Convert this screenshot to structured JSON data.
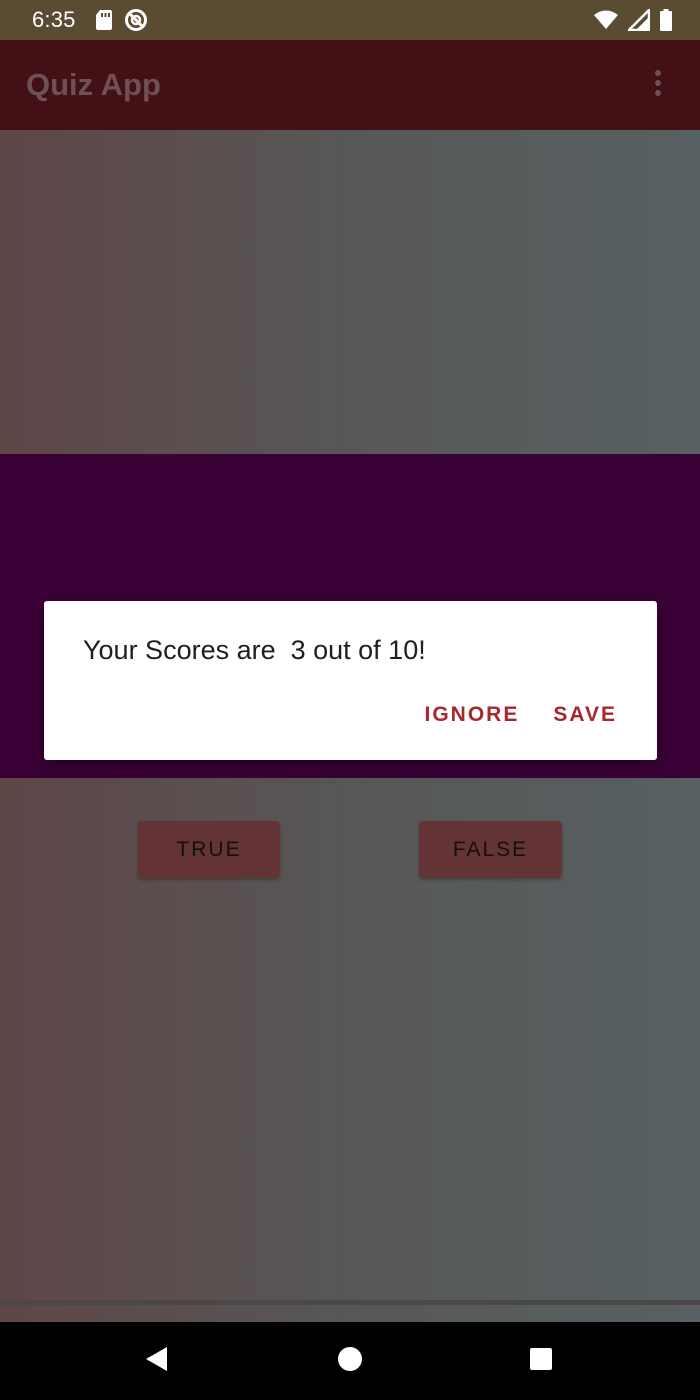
{
  "status_bar": {
    "time": "6:35",
    "icons": [
      "sd-card-icon",
      "do-not-disturb-icon",
      "wifi-icon",
      "signal-icon",
      "battery-icon"
    ]
  },
  "app_bar": {
    "title": "Quiz App",
    "overflow_icon": "more-vert-icon"
  },
  "buttons": {
    "true_label": "TRUE",
    "false_label": "FALSE"
  },
  "dialog": {
    "message": "Your Scores are  3 out of 10!",
    "ignore_label": "IGNORE",
    "save_label": "SAVE"
  },
  "nav_bar": {
    "icons": [
      "back-icon",
      "home-icon",
      "recents-icon"
    ]
  },
  "colors": {
    "status_bar": "#5a4b33",
    "app_bar": "#421015",
    "question_band": "#3a0136",
    "dialog_accent": "#a8272d",
    "answer_button": "#633335"
  }
}
